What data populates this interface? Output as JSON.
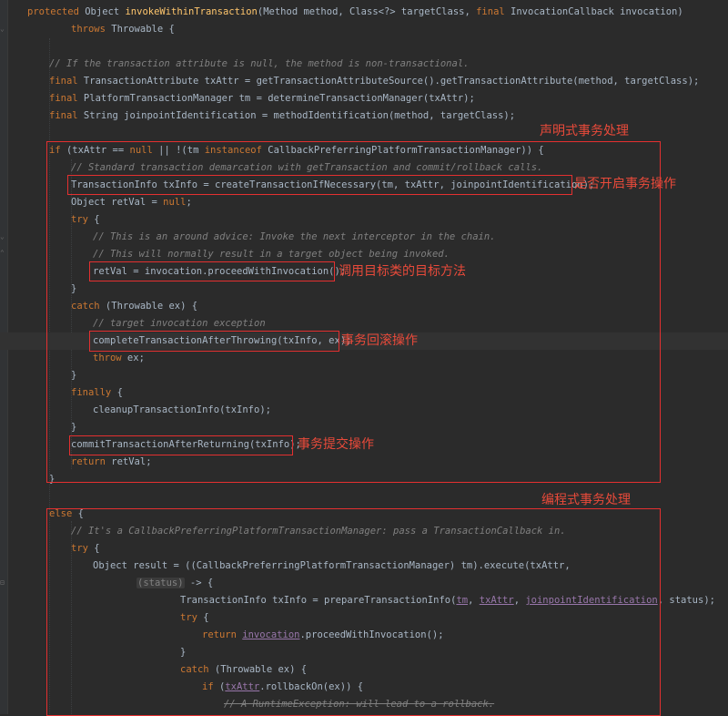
{
  "editor": {
    "lines": {
      "sig1": [
        "protected",
        " Object ",
        "invokeWithinTransaction",
        "(Method method, Class<?> targetClass, ",
        "final",
        " InvocationCallback invocation)"
      ],
      "sig2": [
        "throws",
        " Throwable {"
      ],
      "c1": "// If the transaction attribute is null, the method is non-transactional.",
      "l4": [
        "final",
        " TransactionAttribute txAttr = getTransactionAttributeSource().getTransactionAttribute(method, targetClass);"
      ],
      "l5": [
        "final",
        " PlatformTransactionManager tm = determineTransactionManager(txAttr);"
      ],
      "l6": [
        "final",
        " String joinpointIdentification = methodIdentification(method, targetClass);"
      ],
      "if1": [
        "if",
        " (txAttr == ",
        "null",
        " || !(tm ",
        "instanceof",
        " CallbackPreferringPlatformTransactionManager)) {"
      ],
      "c2": "// Standard transaction demarcation with getTransaction and commit/rollback calls.",
      "l9": "TransactionInfo txInfo = createTransactionIfNecessary(tm, txAttr, joinpointIdentification);",
      "l10": [
        "Object retVal = ",
        "null",
        ";"
      ],
      "try1": [
        "try",
        " {"
      ],
      "c3": "// This is an around advice: Invoke the next interceptor in the chain.",
      "c4": "// This will normally result in a target object being invoked.",
      "l14": "retVal = invocation.proceedWithInvocation();",
      "close1": "}",
      "catch1": [
        "catch",
        " (Throwable ex) {"
      ],
      "c5": "// target invocation exception",
      "l18": "completeTransactionAfterThrowing(txInfo, ex);",
      "l19": [
        "throw",
        " ex;"
      ],
      "close2": "}",
      "finally1": [
        "finally",
        " {"
      ],
      "l22": "cleanupTransactionInfo(txInfo);",
      "close3": "}",
      "l24": "commitTransactionAfterReturning(txInfo);",
      "l25": [
        "return",
        " retVal;"
      ],
      "close4": "}",
      "else1": [
        "else",
        " {"
      ],
      "c6": "// It's a CallbackPreferringPlatformTransactionManager: pass a TransactionCallback in.",
      "try2": [
        "try",
        " {"
      ],
      "l30": "Object result = ((CallbackPreferringPlatformTransactionManager) tm).execute(txAttr,",
      "l31": [
        "(status)",
        " -> {"
      ],
      "l32": [
        "TransactionInfo txInfo = prepareTransactionInfo(",
        "tm",
        ", ",
        "txAttr",
        ", ",
        "joinpointIdentification",
        ", status);"
      ],
      "try3": [
        "try",
        " {"
      ],
      "l34": [
        "return",
        " ",
        "invocation",
        ".proceedWithInvocation();"
      ],
      "close5": "}",
      "catch2": [
        "catch",
        " (Throwable ex) {"
      ],
      "l37": [
        "if",
        " (",
        "txAttr",
        ".rollbackOn(ex)) {"
      ],
      "c7": "// A RuntimeException: will lead to a rollback."
    }
  },
  "annotations": {
    "declarative": "声明式事务处理",
    "is_open": "是否开启事务操作",
    "call_target": "调用目标类的目标方法",
    "rollback": "事务回滚操作",
    "commit": "事务提交操作",
    "programmatic": "编程式事务处理"
  },
  "colors": {
    "background": "#2b2b2b",
    "text": "#a9b7c6",
    "keyword": "#cc7832",
    "method_decl": "#ffc66d",
    "comment": "#808080",
    "field": "#9876aa",
    "annotation": "#e84a3a"
  }
}
